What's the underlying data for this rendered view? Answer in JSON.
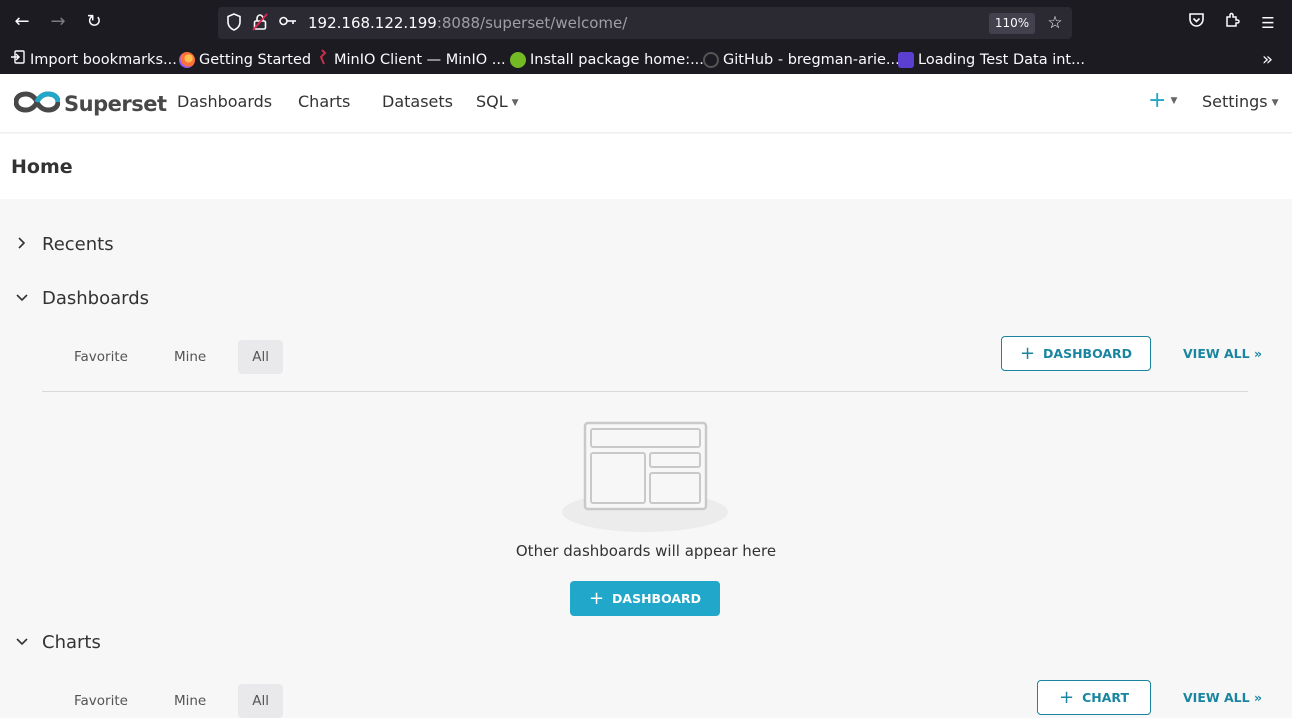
{
  "browser": {
    "url_host": "192.168.122.199",
    "url_rest": ":8088/superset/welcome/",
    "zoom": "110%",
    "bookmarks": [
      {
        "label": "Import bookmarks...",
        "icon": "import-icon",
        "color": "#fbfbfe"
      },
      {
        "label": "Getting Started",
        "icon": "firefox-icon",
        "color": "#ff7139"
      },
      {
        "label": "MinIO Client — MinIO ...",
        "icon": "minio-icon",
        "color": "#c72e49"
      },
      {
        "label": "Install package home:...",
        "icon": "opensuse-icon",
        "color": "#73ba25"
      },
      {
        "label": "GitHub - bregman-arie...",
        "icon": "github-icon",
        "color": "#333333"
      },
      {
        "label": "Loading Test Data int...",
        "icon": "loading-icon",
        "color": "#5b3fd1"
      }
    ]
  },
  "nav": {
    "brand": "Superset",
    "items": [
      "Dashboards",
      "Charts",
      "Datasets",
      "SQL"
    ],
    "plus": "+",
    "settings": "Settings"
  },
  "page": {
    "title": "Home"
  },
  "sections": {
    "recents": {
      "title": "Recents"
    },
    "dashboards": {
      "title": "Dashboards",
      "tabs": [
        "Favorite",
        "Mine",
        "All"
      ],
      "add_button": "DASHBOARD",
      "view_all": "VIEW ALL »",
      "empty_text": "Other dashboards will appear here",
      "empty_button": "DASHBOARD"
    },
    "charts": {
      "title": "Charts",
      "tabs": [
        "Favorite",
        "Mine",
        "All"
      ],
      "add_button": "CHART",
      "view_all": "VIEW ALL »"
    }
  },
  "colors": {
    "accent": "#20a7c9",
    "accent_dark": "#1985a0",
    "browser_bg": "#1c1b22"
  }
}
